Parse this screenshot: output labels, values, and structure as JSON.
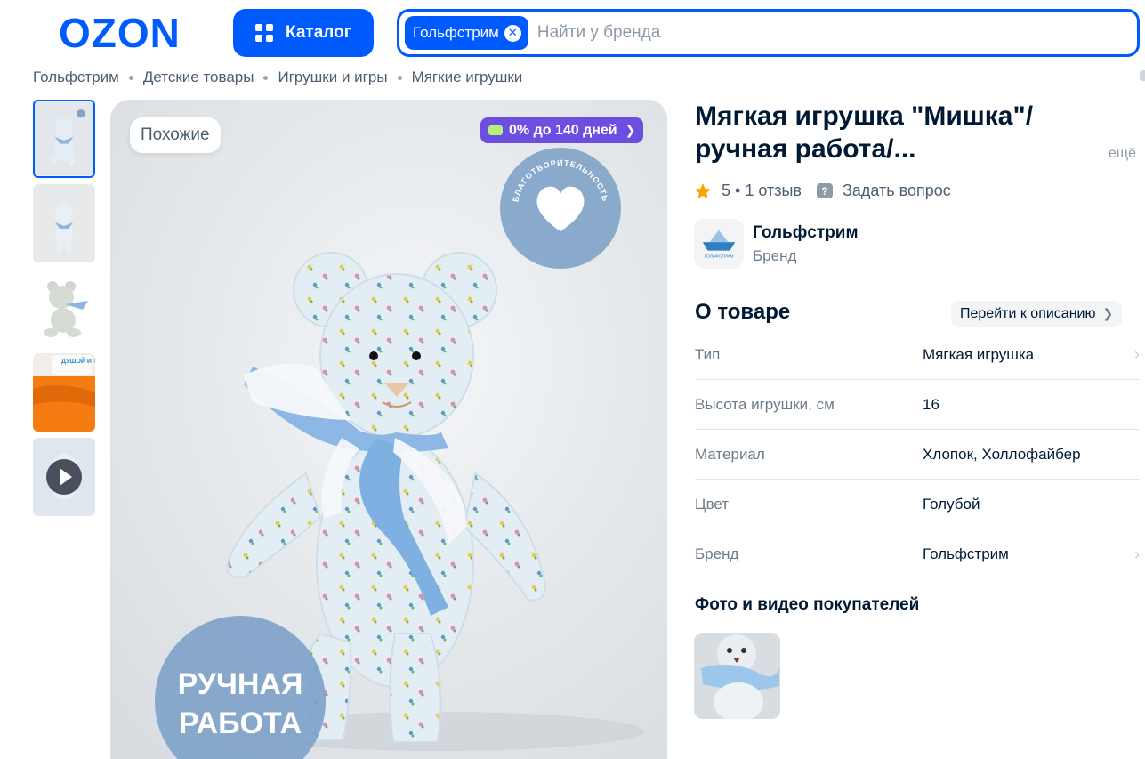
{
  "header": {
    "logo_text": "OZON",
    "catalog_label": "Каталог",
    "search": {
      "chip_label": "Гольфстрим",
      "placeholder": "Найти у бренда"
    }
  },
  "breadcrumbs": [
    "Гольфстрим",
    "Детские товары",
    "Игрушки и игры",
    "Мягкие игрушки"
  ],
  "gallery": {
    "thumbnails": [
      "bear-front",
      "bear-front-2",
      "bear-sitting",
      "handmade-promo",
      "video"
    ],
    "active_index": 0,
    "similar_label": "Похожие",
    "installment_label": "0% до 140 дней",
    "charity_badge_text": "БЛАГОТВОРИТЕЛЬНОСТЬ",
    "handmade_badge_lines": [
      "РУЧНАЯ",
      "РАБОТА"
    ],
    "promo_thumb_text": "ДУШОЙ И ТЕПЛОМ"
  },
  "product": {
    "title": "Мягкая игрушка \"Мишка\"/ ручная работа/...",
    "more_label": "ещё",
    "rating_value": "5",
    "reviews_label": "1 отзыв",
    "ask_label": "Задать вопрос",
    "brand_name": "Гольфстрим",
    "brand_role": "Бренд",
    "brand_logo_text": "ГОЛЬФСТРИМ"
  },
  "about": {
    "title": "О товаре",
    "goto_label": "Перейти к описанию",
    "specs": [
      {
        "key": "Тип",
        "value": "Мягкая игрушка"
      },
      {
        "key": "Высота игрушки, см",
        "value": "16"
      },
      {
        "key": "Материал",
        "value": "Хлопок, Холлофайбер"
      },
      {
        "key": "Цвет",
        "value": "Голубой"
      },
      {
        "key": "Бренд",
        "value": "Гольфстрим"
      }
    ]
  },
  "customer_media": {
    "title": "Фото и видео покупателей"
  },
  "colors": {
    "brand_blue": "#005bff",
    "installment_purple": "#6c4fe0",
    "badge_blue": "#7fa3c9",
    "star": "#f9a500"
  }
}
